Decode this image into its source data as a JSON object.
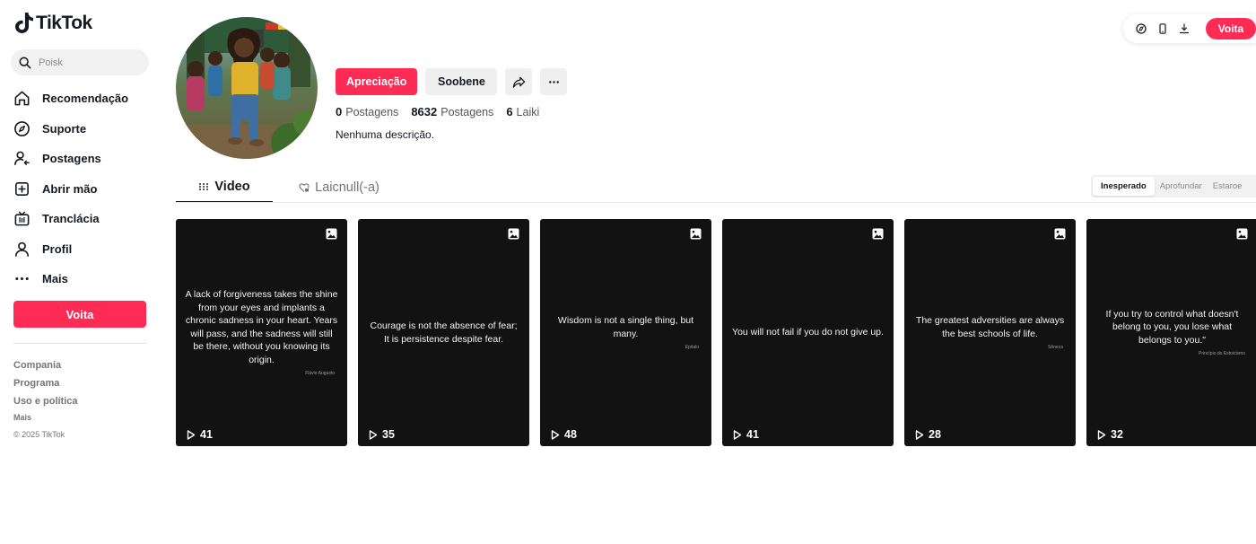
{
  "brand": {
    "name": "TikTok"
  },
  "search": {
    "placeholder": "Poisk"
  },
  "sidebar": {
    "items": [
      {
        "label": "Recomendação",
        "icon": "home-icon"
      },
      {
        "label": "Suporte",
        "icon": "compass-icon"
      },
      {
        "label": "Postagens",
        "icon": "following-icon"
      },
      {
        "label": "Abrir mão",
        "icon": "upload-icon"
      },
      {
        "label": "Tranclácia",
        "icon": "live-icon"
      },
      {
        "label": "Profil",
        "icon": "profile-icon"
      },
      {
        "label": "Mais",
        "icon": "more-icon"
      }
    ],
    "login_label": "Voita",
    "footer_links": [
      "Compania",
      "Programa",
      "Uso e política"
    ],
    "footer_more": "Mais",
    "copyright": "© 2025 TikTok"
  },
  "toolbar": {
    "icons": [
      "coin-icon",
      "phone-icon",
      "download-icon"
    ],
    "login_label": "Voita"
  },
  "profile": {
    "follow_label": "Apreciação",
    "message_label": "Soobene",
    "stats": [
      {
        "value": "0",
        "label": "Postagens"
      },
      {
        "value": "8632",
        "label": "Postagens"
      },
      {
        "value": "6",
        "label": "Laiki"
      }
    ],
    "bio": "Nenhuma descrição."
  },
  "tabs": [
    {
      "label": "Video",
      "icon": "grid-bars-icon"
    },
    {
      "label": "Laicnull(-a)",
      "icon": "heart-lock-icon"
    }
  ],
  "sort_options": [
    "Inesperado",
    "Aprofundar",
    "Estaroe"
  ],
  "sort_selected": "Inesperado",
  "colors": {
    "accent": "#fe2c55",
    "card_bg": "#121212"
  },
  "videos": [
    {
      "quote": "A lack of forgiveness takes the shine from your eyes and implants a chronic sadness in your heart. Years will pass, and the sadness will still be there, without you knowing its origin.",
      "author": "Flávio Augusto",
      "views": "41"
    },
    {
      "quote": "Courage is not the absence of fear; It is persistence despite fear.",
      "author": "",
      "views": "35"
    },
    {
      "quote": "Wisdom is not a single thing, but many.",
      "author": "Epitalo",
      "views": "48"
    },
    {
      "quote": "You will not fail if you do not give up.",
      "author": "",
      "views": "41"
    },
    {
      "quote": "The greatest adversities are always the best schools of life.",
      "author": "Sêneca",
      "views": "28"
    },
    {
      "quote": "If you try to control what doesn't belong to you, you lose what belongs to you.\"",
      "author": "Princípio do Estoicismo",
      "views": "32"
    }
  ]
}
